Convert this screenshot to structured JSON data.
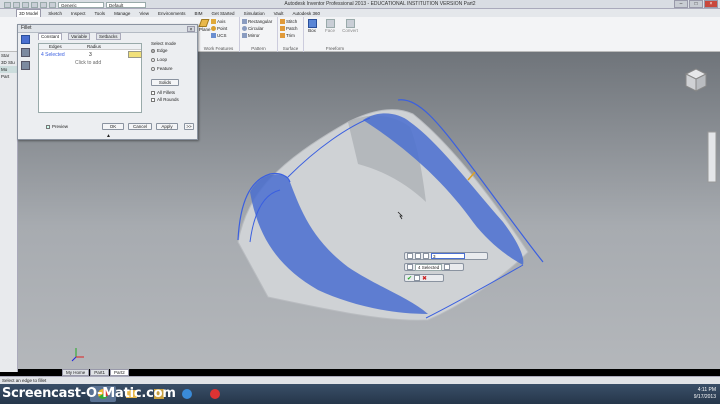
{
  "app": {
    "title": "Autodesk Inventor Professional 2013 - EDUCATIONAL INSTITUTION VERSION   Part2",
    "material": "Generic",
    "appearance": "Default"
  },
  "tabs": [
    "3D Model",
    "Sketch",
    "Inspect",
    "Tools",
    "Manage",
    "View",
    "Environments",
    "BIM",
    "Get Started",
    "Simulation",
    "Vault",
    "Autodesk 360"
  ],
  "ribbon": {
    "work_features": {
      "label": "Work Features",
      "items": [
        "Axis",
        "Point",
        "UCS"
      ],
      "plane": "Plane"
    },
    "pattern": {
      "label": "Pattern",
      "items": [
        "Rectangular",
        "Circular",
        "Mirror"
      ]
    },
    "surface": {
      "label": "Surface",
      "items": [
        "Stitch",
        "Patch",
        "Trim"
      ]
    },
    "freeform": {
      "label": "Freeform",
      "box": "Box",
      "face": "Face",
      "convert": "Convert"
    }
  },
  "left_panel": {
    "items": [
      "Star",
      "3D Stu",
      "Mo",
      "Part"
    ]
  },
  "dialog": {
    "title": "Fillet",
    "tabs": [
      "Constant",
      "Variable",
      "Setbacks"
    ],
    "table": {
      "col_edges": "Edges",
      "col_radius": "Radius",
      "row_edges": "4 Selected",
      "row_radius": "3",
      "add_hint": "Click to add"
    },
    "select_mode": {
      "label": "Select mode",
      "options": [
        "Edge",
        "Loop",
        "Feature"
      ],
      "selected": "Edge"
    },
    "solids_label": "Solids",
    "all_fillets": "All Fillets",
    "all_rounds": "All Rounds",
    "preview": "Preview",
    "ok": "OK",
    "cancel": "Cancel",
    "apply": "Apply",
    "more": ">>"
  },
  "minitoolbar": {
    "value": "3",
    "selected": "4 Selected"
  },
  "doc_tabs": [
    "My Home",
    "Part1",
    "Part2"
  ],
  "status": "Select an edge to fillet",
  "watermark": "Screencast-O-Matic.com",
  "clock": {
    "time": "4:11 PM",
    "date": "9/17/2013"
  },
  "colors": {
    "highlight": "#4a6fd0",
    "surface": "#cfd2d5",
    "viewport_top": "#6f747a",
    "viewport_bottom": "#b4b7bb"
  }
}
